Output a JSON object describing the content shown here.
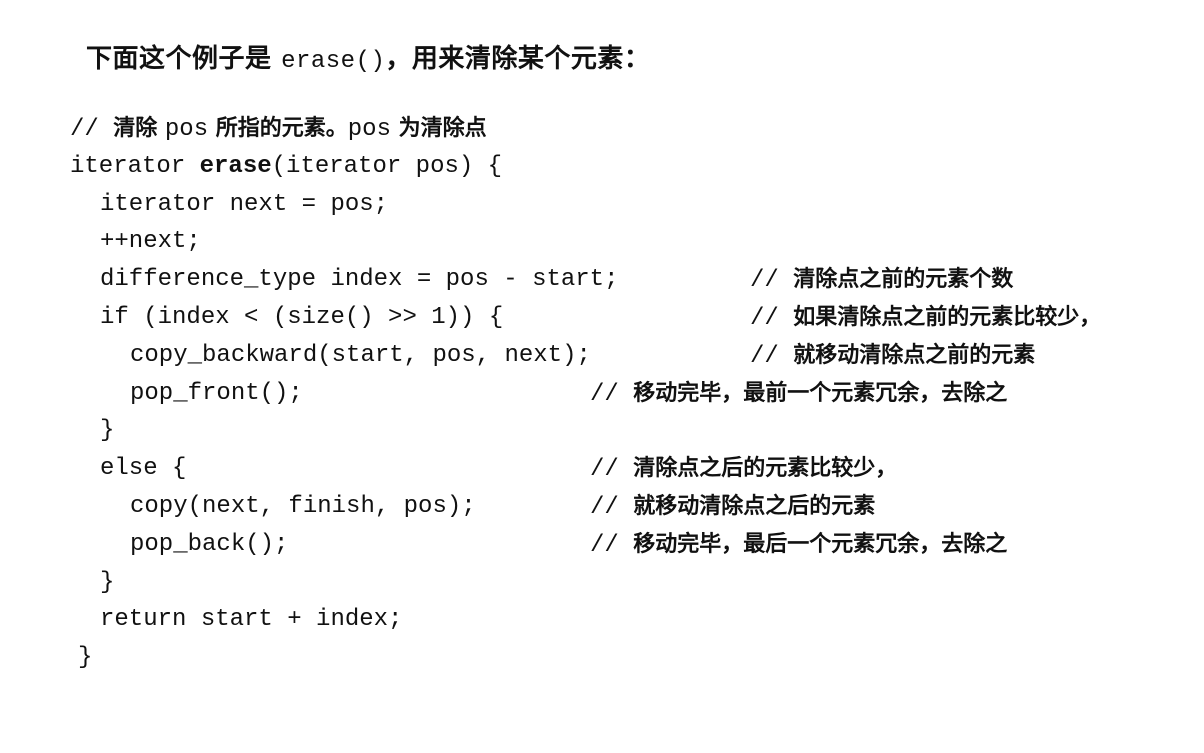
{
  "intro": {
    "prefix": "下面这个例子是 ",
    "func": "erase()",
    "suffix": "，用来清除某个元素："
  },
  "code": {
    "comment0": {
      "slashes": "// ",
      "text1": "清除 ",
      "mono1": "pos",
      "text2": " 所指的元素。",
      "mono2": "pos",
      "text3": " 为清除点"
    },
    "sig_pre": "iterator ",
    "sig_bold": "erase",
    "sig_post": "(iterator pos) {",
    "l1": "iterator next = pos;",
    "l2": "++next;",
    "l3": "difference_type index = pos - start;",
    "l3c": "清除点之前的元素个数",
    "l4": "if (index < (size() >> 1)) {",
    "l4c": "如果清除点之前的元素比较少，",
    "l5": "copy_backward(start, pos, next);",
    "l5c": "就移动清除点之前的元素",
    "l6": "pop_front();",
    "l6c": "移动完毕，最前一个元素冗余，去除之",
    "l7": "}",
    "l8": "else {",
    "l8c": "清除点之后的元素比较少，",
    "l9": "copy(next, finish, pos);",
    "l9c": "就移动清除点之后的元素",
    "l10": "pop_back();",
    "l10c": "移动完毕，最后一个元素冗余，去除之",
    "l11": "}",
    "l12": "return start + index;",
    "l13": "}",
    "slashes": "// "
  }
}
